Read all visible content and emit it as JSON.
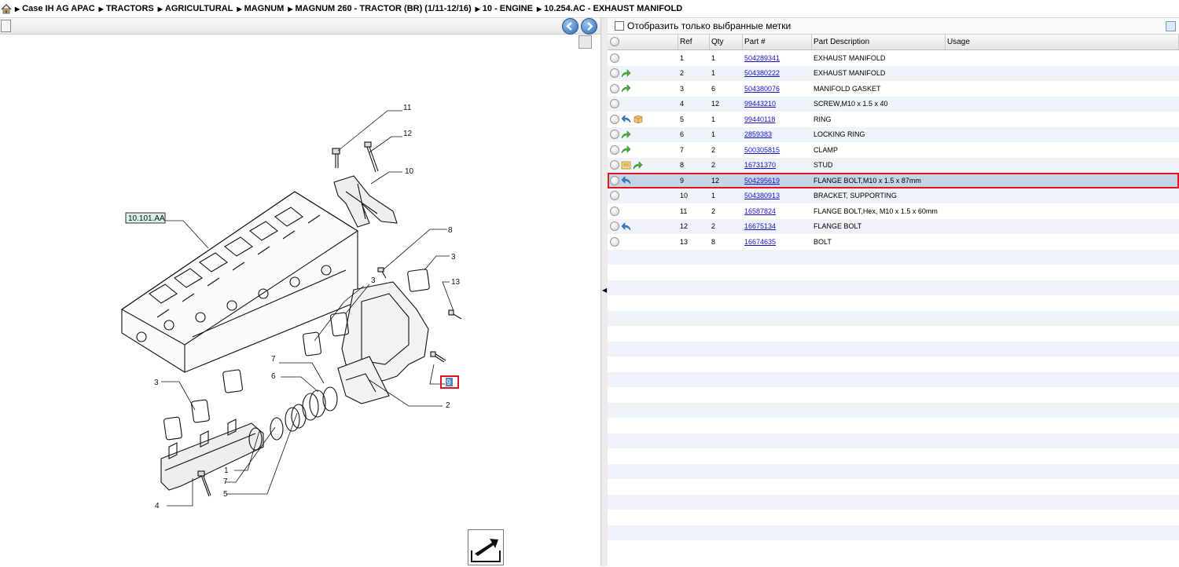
{
  "breadcrumb": [
    "Case IH AG APAC",
    "TRACTORS",
    "AGRICULTURAL",
    "MAGNUM",
    "MAGNUM 260 - TRACTOR (BR) (1/11-12/16)",
    "10 - ENGINE",
    "10.254.AC - EXHAUST MANIFOLD"
  ],
  "filter": {
    "label": "Отобразить только выбранные метки",
    "checked": false
  },
  "table": {
    "headers": [
      "Ref",
      "Qty",
      "Part #",
      "Part Description",
      "Usage"
    ],
    "rows": [
      {
        "ref": "1",
        "qty": "1",
        "part": "504289341",
        "desc": "EXHAUST MANIFOLD",
        "icons": []
      },
      {
        "ref": "2",
        "qty": "1",
        "part": "504380222",
        "desc": "EXHAUST MANIFOLD",
        "icons": [
          "arrow-forward-green-icon"
        ]
      },
      {
        "ref": "3",
        "qty": "6",
        "part": "504380076",
        "desc": "MANIFOLD GASKET",
        "icons": [
          "arrow-forward-green-icon"
        ]
      },
      {
        "ref": "4",
        "qty": "12",
        "part": "99443210",
        "desc": "SCREW,M10 x 1.5 x 40",
        "icons": []
      },
      {
        "ref": "5",
        "qty": "1",
        "part": "99440118",
        "desc": "RING",
        "icons": [
          "arrow-back-blue-icon",
          "package-icon"
        ]
      },
      {
        "ref": "6",
        "qty": "1",
        "part": "2859383",
        "desc": "LOCKING RING",
        "icons": [
          "arrow-forward-green-icon"
        ]
      },
      {
        "ref": "7",
        "qty": "2",
        "part": "500305815",
        "desc": "CLAMP",
        "icons": [
          "arrow-forward-green-icon"
        ]
      },
      {
        "ref": "8",
        "qty": "2",
        "part": "16731370",
        "desc": "STUD",
        "icons": [
          "note-icon",
          "arrow-forward-green-icon"
        ]
      },
      {
        "ref": "9",
        "qty": "12",
        "part": "504295619",
        "desc": "FLANGE BOLT,M10 x 1.5 x 87mm",
        "icons": [
          "arrow-back-blue-icon"
        ],
        "selected": true
      },
      {
        "ref": "10",
        "qty": "1",
        "part": "504380913",
        "desc": "BRACKET, SUPPORTING",
        "icons": []
      },
      {
        "ref": "11",
        "qty": "2",
        "part": "16587824",
        "desc": "FLANGE BOLT,Hex, M10 x 1.5 x 60mm",
        "icons": []
      },
      {
        "ref": "12",
        "qty": "2",
        "part": "16675134",
        "desc": "FLANGE BOLT",
        "icons": [
          "arrow-back-blue-icon"
        ]
      },
      {
        "ref": "13",
        "qty": "8",
        "part": "16674635",
        "desc": "BOLT",
        "icons": []
      }
    ]
  },
  "diagram": {
    "ref_tag": "10.101.AA",
    "selected_callout": "9",
    "callouts": [
      "11",
      "12",
      "10",
      "8",
      "3",
      "13",
      "3",
      "7",
      "6",
      "2",
      "3",
      "1",
      "7",
      "5",
      "4"
    ]
  },
  "colors": {
    "link": "#1a12c9",
    "selection": "#e3141e",
    "row_alt": "#edf3f9",
    "row_selected": "#c4d5e6"
  }
}
